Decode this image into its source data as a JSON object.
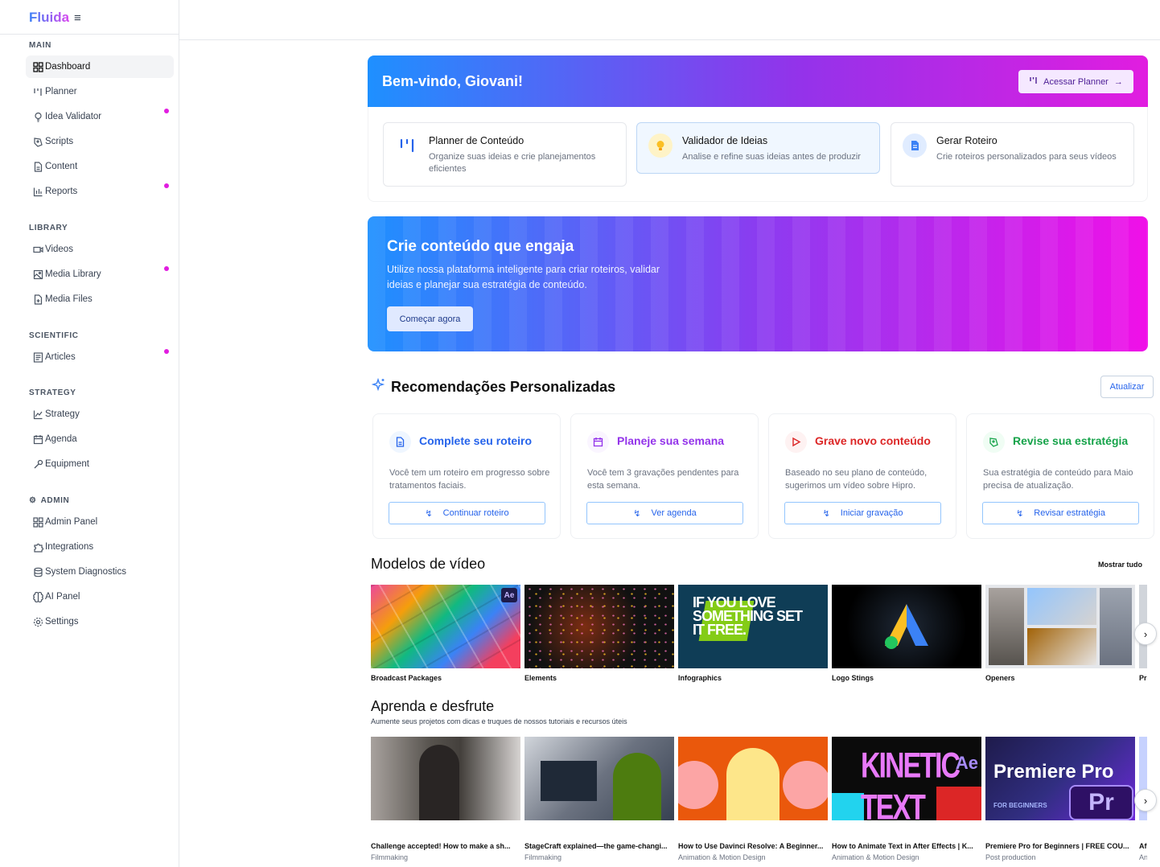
{
  "brand": "Fluida",
  "sidebar": {
    "sections": [
      {
        "title": "MAIN",
        "items": [
          {
            "label": "Dashboard",
            "icon": "dashboard-icon"
          },
          {
            "label": "Planner",
            "icon": "planner-icon"
          },
          {
            "label": "Idea Validator",
            "icon": "lightbulb-icon"
          },
          {
            "label": "Scripts",
            "icon": "script-icon"
          },
          {
            "label": "Content",
            "icon": "document-icon"
          },
          {
            "label": "Reports",
            "icon": "bar-chart-icon"
          }
        ]
      },
      {
        "title": "LIBRARY",
        "items": [
          {
            "label": "Videos",
            "icon": "video-icon"
          },
          {
            "label": "Media Library",
            "icon": "image-icon"
          },
          {
            "label": "Media Files",
            "icon": "file-plus-icon"
          }
        ]
      },
      {
        "title": "SCIENTIFIC",
        "items": [
          {
            "label": "Articles",
            "icon": "article-icon"
          }
        ]
      },
      {
        "title": "STRATEGY",
        "items": [
          {
            "label": "Strategy",
            "icon": "line-chart-icon"
          },
          {
            "label": "Agenda",
            "icon": "calendar-icon"
          },
          {
            "label": "Equipment",
            "icon": "wrench-icon"
          }
        ]
      },
      {
        "title": "ADMIN",
        "items": [
          {
            "label": "Admin Panel",
            "icon": "grid-icon"
          },
          {
            "label": "Integrations",
            "icon": "puzzle-icon"
          },
          {
            "label": "System Diagnostics",
            "icon": "database-icon"
          },
          {
            "label": "AI Panel",
            "icon": "brain-icon"
          },
          {
            "label": "Settings",
            "icon": "settings-icon"
          }
        ]
      }
    ]
  },
  "welcome": {
    "title": "Bem-vindo, Giovani!",
    "button": "Acessar Planner"
  },
  "quick_cards": [
    {
      "title": "Planner de Conteúdo",
      "desc": "Organize suas ideias e crie planejamentos eficientes"
    },
    {
      "title": "Validador de Ideias",
      "desc": "Analise e refine suas ideias antes de produzir"
    },
    {
      "title": "Gerar Roteiro",
      "desc": "Crie roteiros personalizados para seus vídeos"
    }
  ],
  "hero": {
    "title": "Crie conteúdo que engaja",
    "text": "Utilize nossa plataforma inteligente para criar roteiros, validar ideias e planejar sua estratégia de conteúdo.",
    "button": "Começar agora"
  },
  "recommendations": {
    "title": "Recomendações Personalizadas",
    "refresh": "Atualizar",
    "cards": [
      {
        "title": "Complete seu roteiro",
        "desc": "Você tem um roteiro em progresso sobre tratamentos faciais.",
        "button": "Continuar roteiro",
        "color": "#2563eb"
      },
      {
        "title": "Planeje sua semana",
        "desc": "Você tem 3 gravações pendentes para esta semana.",
        "button": "Ver agenda",
        "color": "#9333ea"
      },
      {
        "title": "Grave novo conteúdo",
        "desc": "Baseado no seu plano de conteúdo, sugerimos um vídeo sobre Hipro.",
        "button": "Iniciar gravação",
        "color": "#dc2626"
      },
      {
        "title": "Revise sua estratégia",
        "desc": "Sua estratégia de conteúdo para Maio precisa de atualização.",
        "button": "Revisar estratégia",
        "color": "#16a34a"
      }
    ]
  },
  "templates": {
    "title": "Modelos de vídeo",
    "show_all": "Mostrar tudo",
    "items": [
      {
        "label": "Broadcast Packages"
      },
      {
        "label": "Elements"
      },
      {
        "label": "Infographics",
        "thumb_text": "IF YOU LOVE SOMETHING SET IT FREE."
      },
      {
        "label": "Logo Stings"
      },
      {
        "label": "Openers"
      }
    ],
    "cut_label": "Pr"
  },
  "learn": {
    "title": "Aprenda e desfrute",
    "subtitle": "Aumente seus projetos com dicas e truques de nossos tutoriais e recursos úteis",
    "items": [
      {
        "label": "Challenge accepted! How to make a sh...",
        "category": "Filmmaking"
      },
      {
        "label": "StageCraft explained—the game-changi...",
        "category": "Filmmaking"
      },
      {
        "label": "How to Use Davinci Resolve: A Beginner...",
        "category": "Animation & Motion Design"
      },
      {
        "label": "How to Animate Text in After Effects | K...",
        "category": "Animation & Motion Design",
        "thumb_text": "KINETIC TEXT"
      },
      {
        "label": "Premiere Pro for Beginners | FREE COU...",
        "category": "Post production",
        "thumb_title": "Premiere Pro",
        "thumb_sub": "FOR BEGINNERS"
      }
    ],
    "cut_label": "Af",
    "cut_category": "An"
  }
}
